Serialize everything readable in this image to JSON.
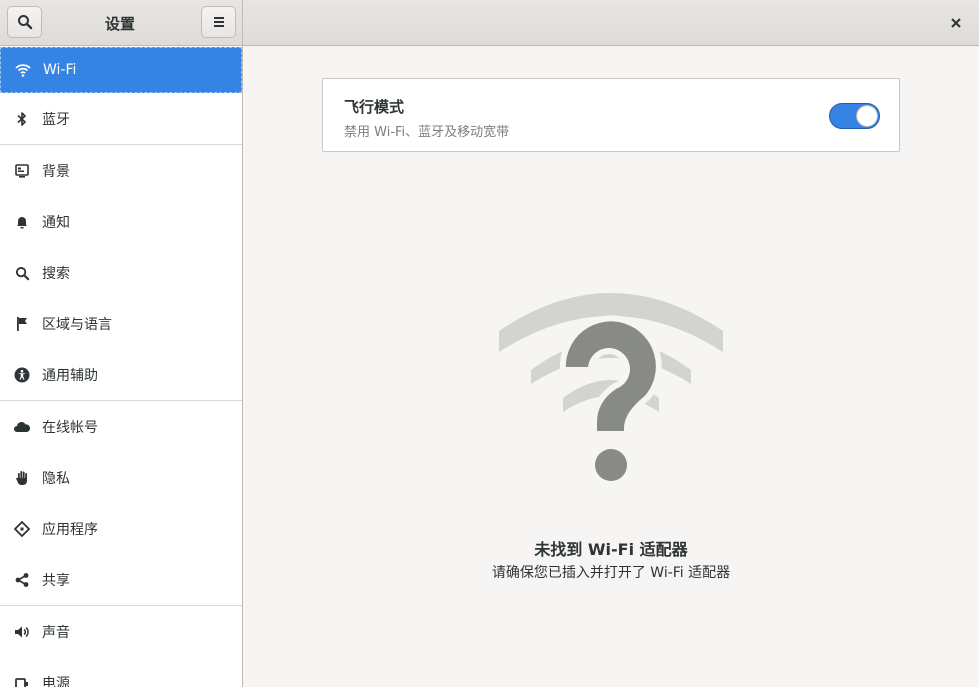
{
  "header": {
    "app_title": "设置",
    "search_icon": "search-icon",
    "menu_icon": "hamburger-menu-icon",
    "close_icon": "close-icon"
  },
  "sidebar": {
    "items": [
      {
        "label": "Wi-Fi",
        "icon": "wifi-icon",
        "active": true
      },
      {
        "label": "蓝牙",
        "icon": "bluetooth-icon"
      },
      {
        "label": "背景",
        "icon": "background-icon"
      },
      {
        "label": "通知",
        "icon": "bell-icon"
      },
      {
        "label": "搜索",
        "icon": "search-icon"
      },
      {
        "label": "区域与语言",
        "icon": "flag-icon"
      },
      {
        "label": "通用辅助",
        "icon": "accessibility-icon"
      },
      {
        "label": "在线帐号",
        "icon": "cloud-icon"
      },
      {
        "label": "隐私",
        "icon": "hand-icon"
      },
      {
        "label": "应用程序",
        "icon": "apps-icon"
      },
      {
        "label": "共享",
        "icon": "share-icon"
      },
      {
        "label": "声音",
        "icon": "speaker-icon"
      },
      {
        "label": "电源",
        "icon": "power-icon"
      }
    ]
  },
  "airplane_mode": {
    "title": "飞行模式",
    "subtitle": "禁用 Wi-Fi、蓝牙及移动宽带",
    "enabled": true
  },
  "empty_state": {
    "icon": "wifi-unknown-icon",
    "title": "未找到 Wi-Fi 适配器",
    "subtitle": "请确保您已插入并打开了 Wi-Fi 适配器"
  },
  "colors": {
    "accent": "#3584e4",
    "sidebar_bg": "#ffffff",
    "content_bg": "#f6f5f4",
    "icon_gray": "#888a85"
  }
}
